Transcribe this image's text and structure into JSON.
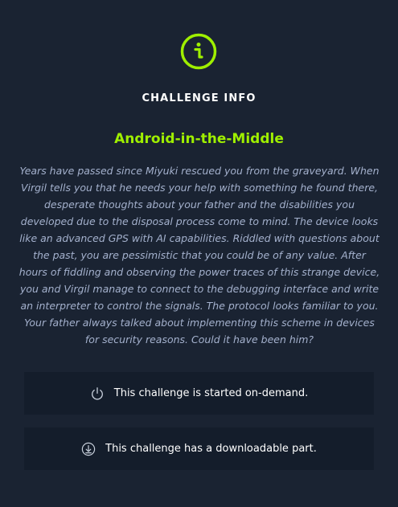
{
  "modal": {
    "icon": "info-circle-icon",
    "heading": "CHALLENGE INFO",
    "challenge_name": "Android-in-the-Middle",
    "description": "Years have passed since Miyuki rescued you from the graveyard. When Virgil tells you that he needs your help with something he found there, desperate thoughts about your father and the disabilities you developed due to the disposal process come to mind. The device looks like an advanced GPS with AI capabilities. Riddled with questions about the past, you are pessimistic that you could be of any value. After hours of fiddling and observing the power traces of this strange device, you and Virgil manage to connect to the debugging interface and write an interpreter to control the signals. The protocol looks familiar to you. Your father always talked about implementing this scheme in devices for security reasons. Could it have been him?",
    "notes": [
      {
        "icon": "power-icon",
        "text": "This challenge is started on-demand."
      },
      {
        "icon": "download-icon",
        "text": "This challenge has a downloadable part."
      }
    ]
  },
  "colors": {
    "background": "#1a2332",
    "panel": "#141d2b",
    "accent_green": "#9fef00",
    "muted_text": "#a4b1cd",
    "text": "#ffffff"
  }
}
